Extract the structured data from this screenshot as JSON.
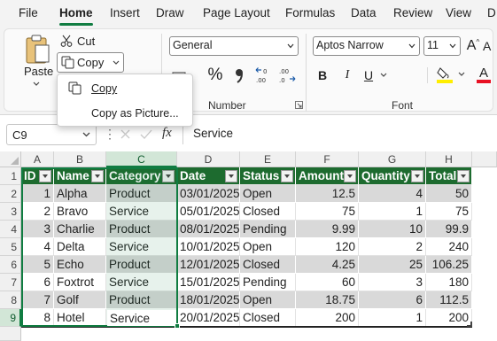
{
  "menu": {
    "tabs": [
      "File",
      "Home",
      "Insert",
      "Draw",
      "Page Layout",
      "Formulas",
      "Data",
      "Review",
      "View",
      "D"
    ],
    "active": "Home"
  },
  "ribbon": {
    "clipboard": {
      "paste_label": "Paste",
      "cut_label": "Cut",
      "copy_label": "Copy"
    },
    "copy_menu": {
      "items": [
        "Copy",
        "Copy as Picture..."
      ]
    },
    "number": {
      "format_value": "General",
      "group_label": "Number",
      "percent_symbol": "%",
      "comma_symbol": "9"
    },
    "font": {
      "font_name": "Aptos Narrow",
      "font_size": "11",
      "group_label": "Font",
      "bold": "B",
      "italic": "I",
      "underline": "U",
      "increase_font": "A",
      "decrease_font": "A",
      "font_color_glyph": "A",
      "fill_color": "#ffee00",
      "font_color": "#e81123"
    }
  },
  "formula_bar": {
    "name_box": "C9",
    "fx": "fx",
    "value": "Service"
  },
  "sheet": {
    "columns": [
      "A",
      "B",
      "C",
      "D",
      "E",
      "F",
      "G",
      "H"
    ],
    "rows": [
      "1",
      "2",
      "3",
      "4",
      "5",
      "6",
      "7",
      "8",
      "9"
    ],
    "selected_column": "C",
    "selected_cell": "C9",
    "table": {
      "headers": [
        "ID",
        "Name",
        "Category",
        "Date",
        "Status",
        "Amount",
        "Quantity",
        "Total"
      ],
      "rows": [
        [
          "1",
          "Alpha",
          "Product",
          "03/01/2025",
          "Open",
          "12.5",
          "4",
          "50"
        ],
        [
          "2",
          "Bravo",
          "Service",
          "05/01/2025",
          "Closed",
          "75",
          "1",
          "75"
        ],
        [
          "3",
          "Charlie",
          "Product",
          "08/01/2025",
          "Pending",
          "9.99",
          "10",
          "99.9"
        ],
        [
          "4",
          "Delta",
          "Service",
          "10/01/2025",
          "Open",
          "120",
          "2",
          "240"
        ],
        [
          "5",
          "Echo",
          "Product",
          "12/01/2025",
          "Closed",
          "4.25",
          "25",
          "106.25"
        ],
        [
          "6",
          "Foxtrot",
          "Service",
          "15/01/2025",
          "Pending",
          "60",
          "3",
          "180"
        ],
        [
          "7",
          "Golf",
          "Product",
          "18/01/2025",
          "Open",
          "18.75",
          "6",
          "112.5"
        ],
        [
          "8",
          "Hotel",
          "Service",
          "20/01/2025",
          "Closed",
          "200",
          "1",
          "200"
        ]
      ],
      "header_color": "#1d6b2f",
      "band_color": "#d9d9d9"
    }
  },
  "colors": {
    "accent": "#107c41",
    "ribbon_bg": "#f3f3f3"
  }
}
